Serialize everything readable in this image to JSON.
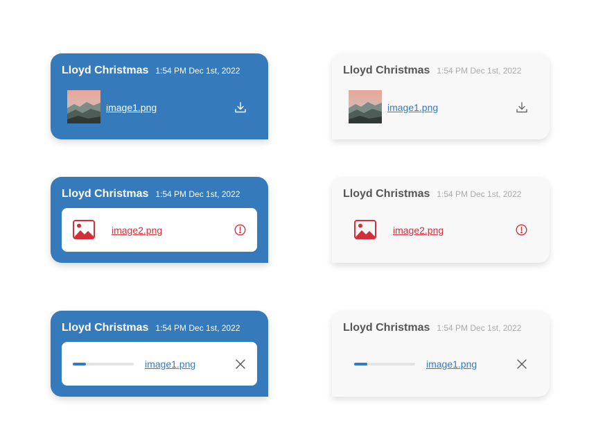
{
  "messages": [
    {
      "sender": "Lloyd Christmas",
      "time": "1:54 PM Dec 1st, 2022",
      "file": "image1.png",
      "state": "complete"
    },
    {
      "sender": "Lloyd Christmas",
      "time": "1:54 PM Dec 1st, 2022",
      "file": "image2.png",
      "state": "error"
    },
    {
      "sender": "Lloyd Christmas",
      "time": "1:54 PM Dec 1st, 2022",
      "file": "image1.png",
      "state": "uploading",
      "progress": 0.22
    }
  ],
  "colors": {
    "sent_bubble": "#357abb",
    "received_bubble": "#f8f8f8",
    "link": "#2f7ad0",
    "error": "#d0303c"
  },
  "icons": [
    "download-icon",
    "image-placeholder-icon",
    "error-icon",
    "close-icon"
  ]
}
